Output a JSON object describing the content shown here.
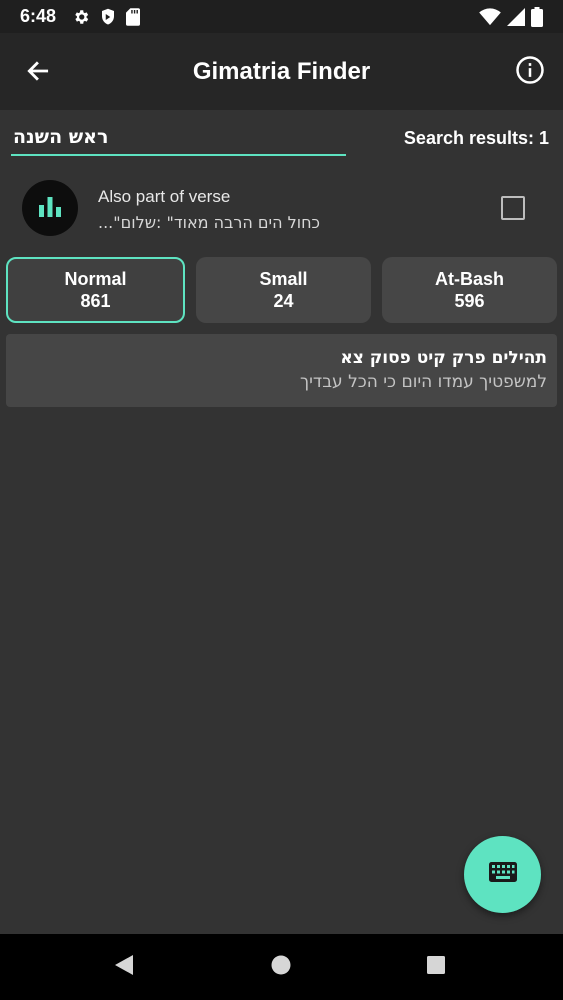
{
  "status_bar": {
    "time": "6:48",
    "icons": [
      "gear-icon",
      "shield-icon",
      "sd-card-icon",
      "wifi-icon",
      "signal-icon",
      "battery-icon"
    ]
  },
  "app_bar": {
    "title": "Gimatria Finder",
    "back_icon": "arrow-left-icon",
    "info_icon": "info-icon"
  },
  "search": {
    "value": "ראש השנה",
    "results_label": "Search results: 1"
  },
  "verse_option": {
    "title": "Also part of verse",
    "subtitle": "...\"כחול הים הרבה מאוד\" :שלום",
    "checked": false,
    "icon": "bar-chart-icon"
  },
  "tabs": [
    {
      "label": "Normal",
      "value": "861",
      "active": true
    },
    {
      "label": "Small",
      "value": "24",
      "active": false
    },
    {
      "label": "At-Bash",
      "value": "596",
      "active": false
    }
  ],
  "results": [
    {
      "title": "תהילים פרק קיט פסוק צא",
      "text": "למשפטיך עמדו היום כי הכל עבדיך"
    }
  ],
  "fab": {
    "icon": "keyboard-icon"
  },
  "nav_bar": {
    "icons": [
      "back-triangle-icon",
      "home-circle-icon",
      "recents-square-icon"
    ]
  },
  "colors": {
    "accent": "#5ee3c1",
    "background": "#333333",
    "app_bar": "#262626",
    "card": "#464646"
  }
}
